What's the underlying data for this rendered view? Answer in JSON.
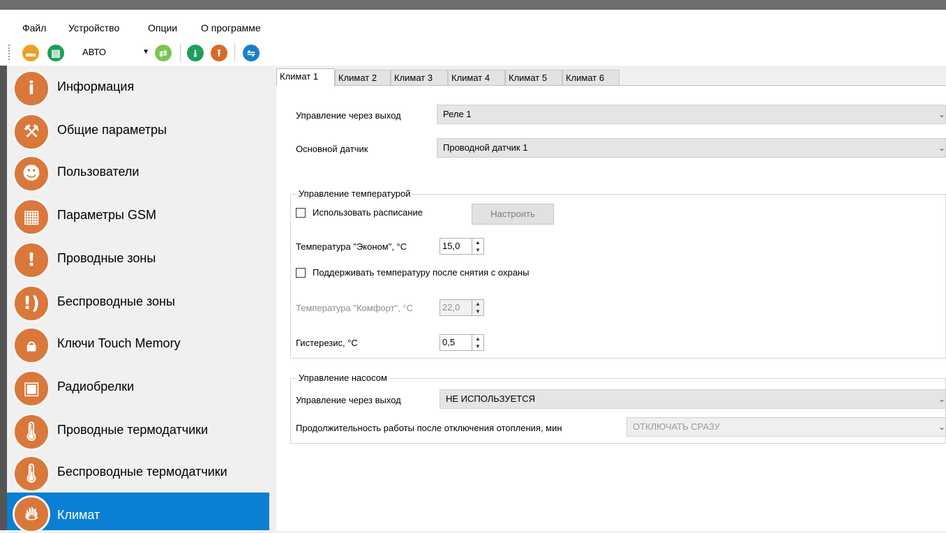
{
  "menu": {
    "items": [
      "Файл",
      "Устройство",
      "Опции",
      "О программе"
    ]
  },
  "toolbar": {
    "mode_value": "АВТО",
    "icons": [
      "folder-open-icon",
      "save-device-icon",
      "refresh-connect-icon",
      "download-icon",
      "upload-icon",
      "sync-icon"
    ],
    "colors": {
      "orange": "#f0a020",
      "green": "#1e9e5a",
      "blue": "#1a7fc4",
      "red": "#d66a2a"
    }
  },
  "sidebar": {
    "items": [
      {
        "label": "Информация",
        "icon": "info-icon"
      },
      {
        "label": "Общие параметры",
        "icon": "wrench-icon"
      },
      {
        "label": "Пользователи",
        "icon": "users-icon"
      },
      {
        "label": "Параметры GSM",
        "icon": "sim-card-icon"
      },
      {
        "label": "Проводные зоны",
        "icon": "exclamation-icon"
      },
      {
        "label": "Беспроводные зоны",
        "icon": "wireless-exclamation-icon"
      },
      {
        "label": "Ключи Touch Memory",
        "icon": "lock-icon"
      },
      {
        "label": "Радиобрелки",
        "icon": "keyfob-icon"
      },
      {
        "label": "Проводные термодатчики",
        "icon": "thermometer-icon"
      },
      {
        "label": "Беспроводные термодатчики",
        "icon": "wireless-thermometer-icon"
      },
      {
        "label": "Климат",
        "icon": "flame-icon"
      }
    ],
    "active_color": "#0a7fd3",
    "icon_color": "#d9783a"
  },
  "tabs": [
    "Климат 1",
    "Климат 2",
    "Климат 3",
    "Климат 4",
    "Климат 5",
    "Климат 6"
  ],
  "form": {
    "output_label": "Управление через выход",
    "output_value": "Реле 1",
    "sensor_label": "Основной датчик",
    "sensor_value": "Проводной датчик 1",
    "temp_group": {
      "title": "Управление температурой",
      "use_schedule_label": "Использовать расписание",
      "configure_button": "Настроить",
      "econom_label": "Температура \"Эконом\", °C",
      "econom_value": "15,0",
      "keep_temp_label": "Поддерживать температуру после снятия с охраны",
      "comfort_label": "Температура \"Комфорт\", °C",
      "comfort_value": "22,0",
      "hysteresis_label": "Гистерезис, °C",
      "hysteresis_value": "0,5"
    },
    "pump_group": {
      "title": "Управление насосом",
      "output_label": "Управление через выход",
      "output_value": "НЕ ИСПОЛЬЗУЕТСЯ",
      "duration_label": "Продолжительность работы после отключения отопления, мин",
      "duration_value": "ОТКЛЮЧАТЬ СРАЗУ"
    }
  }
}
